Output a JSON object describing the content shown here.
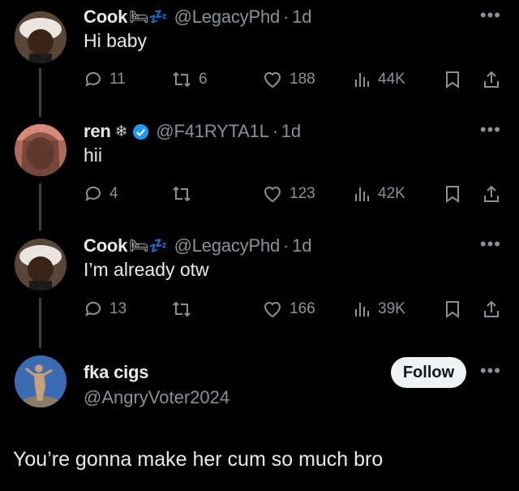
{
  "thread": [
    {
      "name": "Cook",
      "name_emoji": "🛏💤",
      "handle": "@LegacyPhd",
      "time": "1d",
      "text": "Hi baby",
      "replies": "11",
      "reposts": "6",
      "likes": "188",
      "views": "44K",
      "verified": false
    },
    {
      "name": "ren",
      "name_emoji": "❄",
      "handle": "@F41RYTA1L",
      "time": "1d",
      "text": "hii",
      "replies": "4",
      "reposts": "",
      "likes": "123",
      "views": "42K",
      "verified": true
    },
    {
      "name": "Cook",
      "name_emoji": "🛏💤",
      "handle": "@LegacyPhd",
      "time": "1d",
      "text": "I’m already otw",
      "replies": "13",
      "reposts": "",
      "likes": "166",
      "views": "39K",
      "verified": false
    }
  ],
  "focused": {
    "name": "fka cigs",
    "handle": "@AngryVoter2024",
    "follow_label": "Follow",
    "text": "You’re gonna make her cum so much bro"
  },
  "colors": {
    "background": "#000000",
    "text": "#e7e9ea",
    "muted": "#8b9096",
    "verified": "#1d9bf0"
  }
}
